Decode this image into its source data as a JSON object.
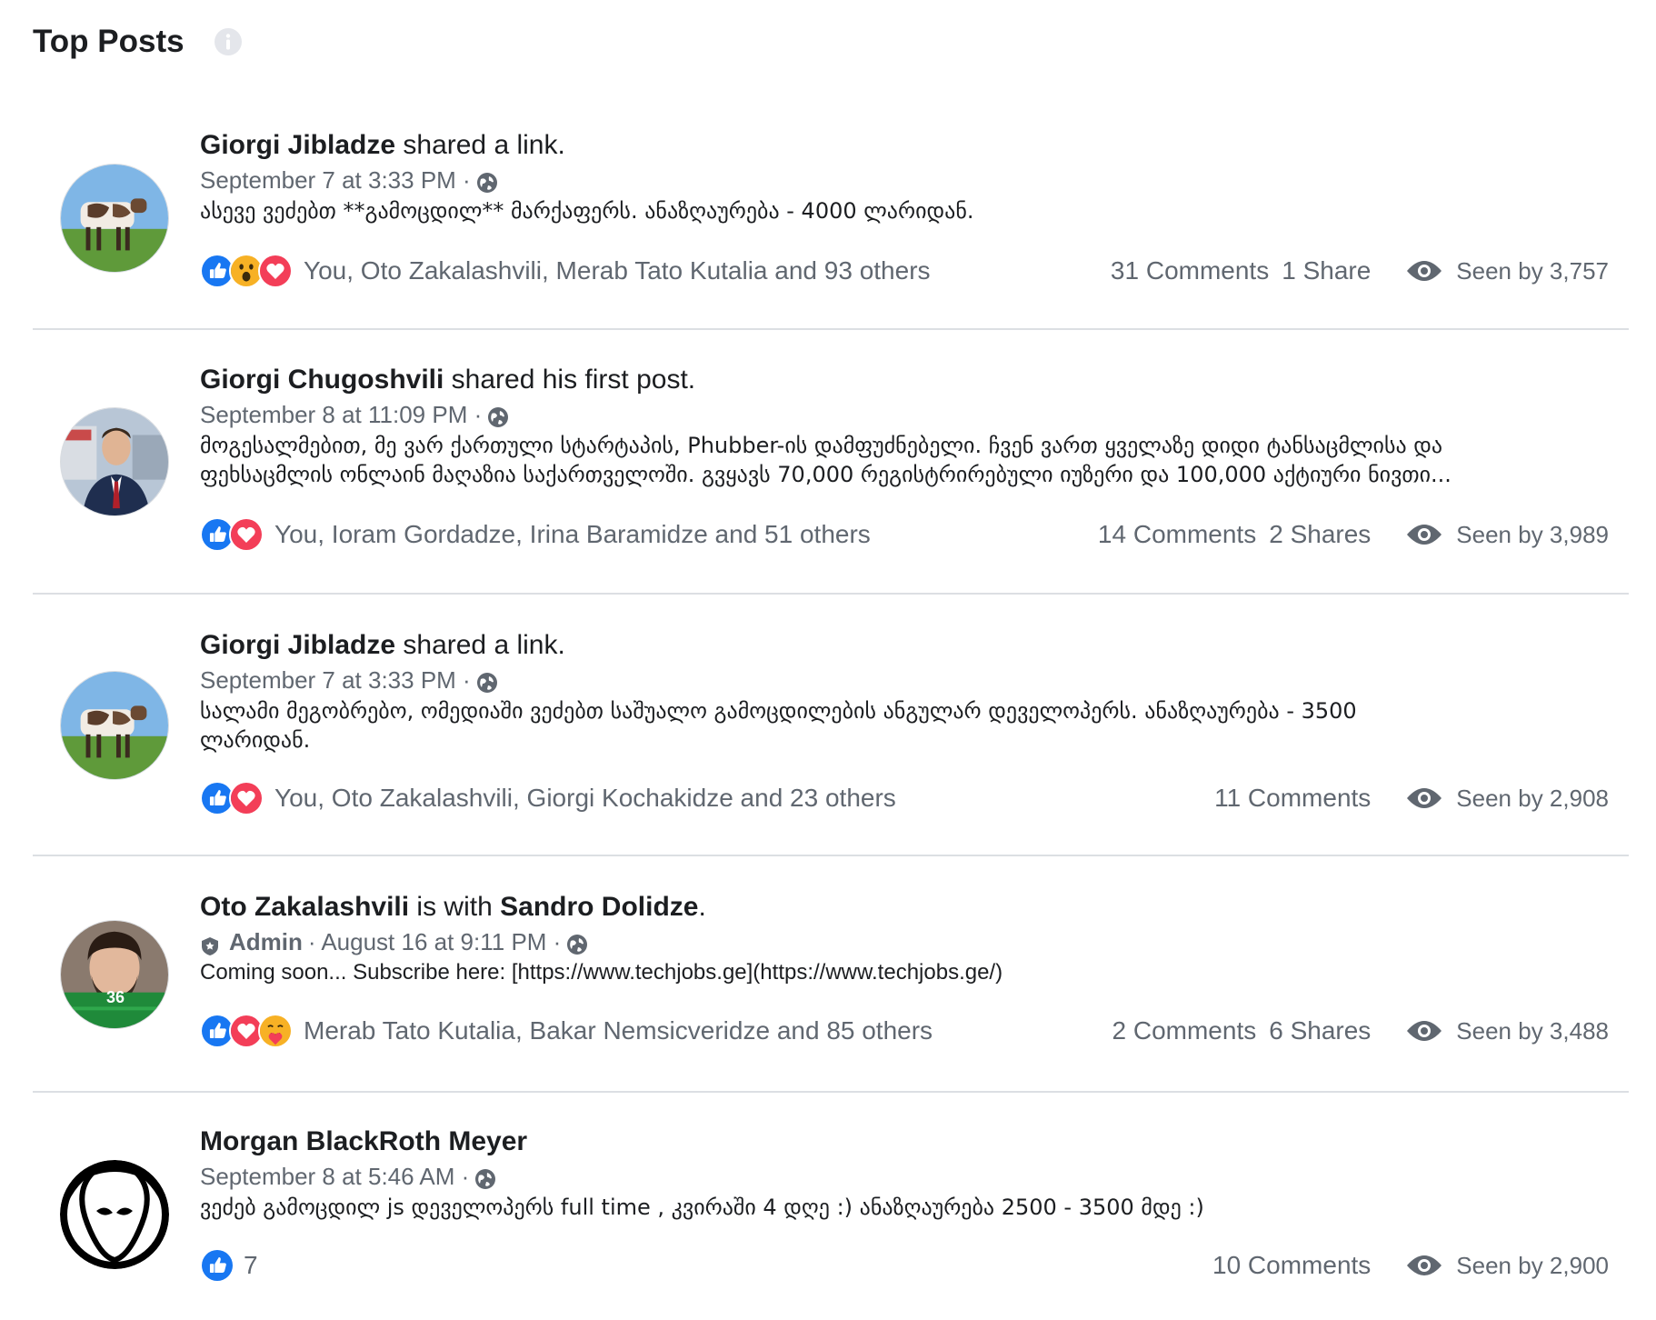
{
  "header": {
    "title": "Top Posts"
  },
  "posts": [
    {
      "author": "Giorgi Jibladze",
      "action": " shared a link.",
      "date": "September 7 at 3:33 PM ·",
      "text_lines": [
        "ასევე ვეძებთ **გამოცდილ** მარქაფერს. ანაზღაურება - 4000 ლარიდან."
      ],
      "reactors": "You, Oto Zakalashvili, Merab Tato Kutalia and 93 others",
      "comments": "31 Comments",
      "shares": "1 Share",
      "seen": "Seen by 3,757"
    },
    {
      "author": "Giorgi Chugoshvili",
      "action": " shared his first post.",
      "date": "September 8 at 11:09 PM ·",
      "text_lines": [
        "მოგესალმებით, მე ვარ ქართული სტარტაპის, Phubber-ის დამფუძნებელი. ჩვენ ვართ ყველაზე დიდი ტანსაცმლისა და",
        "ფეხსაცმლის ონლაინ მაღაზია საქართველოში. გვყავს 70,000 რეგისტრირებული იუზერი და 100,000 აქტიური ნივთი..."
      ],
      "reactors": "You, Ioram Gordadze, Irina Baramidze and 51 others",
      "comments": "14 Comments",
      "shares": "2 Shares",
      "seen": "Seen by 3,989"
    },
    {
      "author": "Giorgi Jibladze",
      "action": " shared a link.",
      "date": "September 7 at 3:33 PM ·",
      "text_lines": [
        "სალამი მეგობრებო, ომედიაში ვეძებთ საშუალო გამოცდილების ანგულარ დეველოპერს. ანაზღაურება - 3500",
        "ლარიდან."
      ],
      "reactors": "You, Oto Zakalashvili, Giorgi Kochakidze and 23 others",
      "comments": "11 Comments",
      "seen": "Seen by 2,908"
    },
    {
      "author": "Oto Zakalashvili",
      "action": " is with ",
      "with": "Sandro Dolidze",
      "action_end": ".",
      "admin": "Admin",
      "date": "· August 16 at 9:11 PM ·",
      "avatar_badge": "36",
      "text_lines": [
        "Coming soon... Subscribe here: [https://www.techjobs.ge](https://www.techjobs.ge/)"
      ],
      "reactors": "Merab Tato Kutalia, Bakar Nemsicveridze and 85 others",
      "comments": "2 Comments",
      "shares": "6 Shares",
      "seen": "Seen by 3,488"
    },
    {
      "author": "Morgan BlackRoth Meyer",
      "date": "September 8 at 5:46 AM ·",
      "text_lines": [
        "ვეძებ გამოცდილ js დეველოპერს full time , კვირაში 4 დღე :) ანაზღაურება 2500 - 3500 მდე :)"
      ],
      "reaction_count": "7",
      "comments": "10 Comments",
      "seen": "Seen by 2,900"
    }
  ],
  "icons": {
    "like": "like-reaction-icon",
    "love": "love-reaction-icon",
    "wow": "wow-reaction-icon",
    "care": "care-reaction-icon",
    "globe": "globe-icon",
    "eye": "eye-icon",
    "info": "info-icon",
    "shield": "admin-shield-icon"
  },
  "colors": {
    "like_blue": "#1877f2",
    "love_red": "#f33e58",
    "wow_yellow": "#f7b125",
    "meta_gray": "#606770",
    "divider": "#dcdfe3"
  }
}
